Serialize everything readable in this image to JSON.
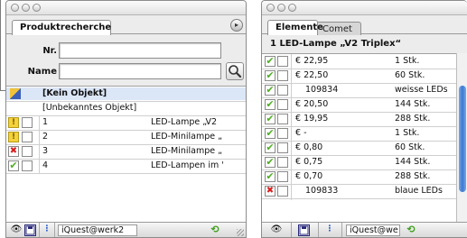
{
  "left_panel": {
    "tab_label": "Produktrecherche",
    "menu_symbol": "▸",
    "nr_label": "Nr.",
    "nr_value": "",
    "name_label": "Name",
    "name_value": "",
    "rows": [
      {
        "name": "[Kein Objekt]",
        "bold": true,
        "icon": "object",
        "selected": true
      },
      {
        "name": "[Unbekanntes Objekt]",
        "bold": false,
        "icon": "none",
        "selected": false
      },
      {
        "status": "warning",
        "status_symbol": "!",
        "id": "1",
        "name": "LED-Lampe  „V2"
      },
      {
        "status": "warning",
        "status_symbol": "!",
        "id": "2",
        "name": "LED-Minilampe „"
      },
      {
        "status": "error",
        "status_symbol": "✖",
        "id": "3",
        "name": "LED-Minilampe „"
      },
      {
        "status": "ok",
        "status_symbol": "✔",
        "id": "4",
        "name": "LED-Lampen im '"
      }
    ],
    "bottom": {
      "preview_symbol": "👁",
      "save_symbol": "💾",
      "info_symbol": "⋮",
      "server_label": "iQuest@werk2",
      "refresh_symbol": "⟲"
    }
  },
  "right_panel": {
    "tabs": [
      {
        "label": "Elemente",
        "active": true
      },
      {
        "label": "Comet",
        "active": false
      }
    ],
    "title": "1 LED-Lampe  „V2 Triplex“",
    "rows": [
      {
        "status": "ok",
        "price": "€ 22,95",
        "qty": "1 Stk."
      },
      {
        "status": "ok",
        "price": "€ 22,50",
        "qty": "60 Stk."
      },
      {
        "status": "ok",
        "price": "109834",
        "qty": "weisse LEDs"
      },
      {
        "status": "ok",
        "price": "€ 20,50",
        "qty": "144 Stk."
      },
      {
        "status": "ok",
        "price": "€ 19,95",
        "qty": "288 Stk."
      },
      {
        "status": "ok",
        "price": "€ -",
        "qty": "1 Stk."
      },
      {
        "status": "ok",
        "price": "€ 0,80",
        "qty": "60 Stk."
      },
      {
        "status": "ok",
        "price": "€ 0,75",
        "qty": "144 Stk."
      },
      {
        "status": "ok",
        "price": "€ 0,70",
        "qty": "288 Stk."
      },
      {
        "status": "error",
        "price": "109833",
        "qty": "blaue LEDs"
      }
    ],
    "ok_symbol": "✔",
    "error_symbol": "✖",
    "bottom": {
      "preview_symbol": "👁",
      "save_symbol": "💾",
      "info_symbol": "⋮",
      "server_label": "iQuest@we",
      "refresh_symbol": "⟲"
    }
  },
  "colors": {
    "selection": "#dbe6f7",
    "ok": "#6cc63b",
    "warning": "#f5d23a",
    "error": "#d81e1e",
    "info_blue": "#1b4fc8"
  }
}
